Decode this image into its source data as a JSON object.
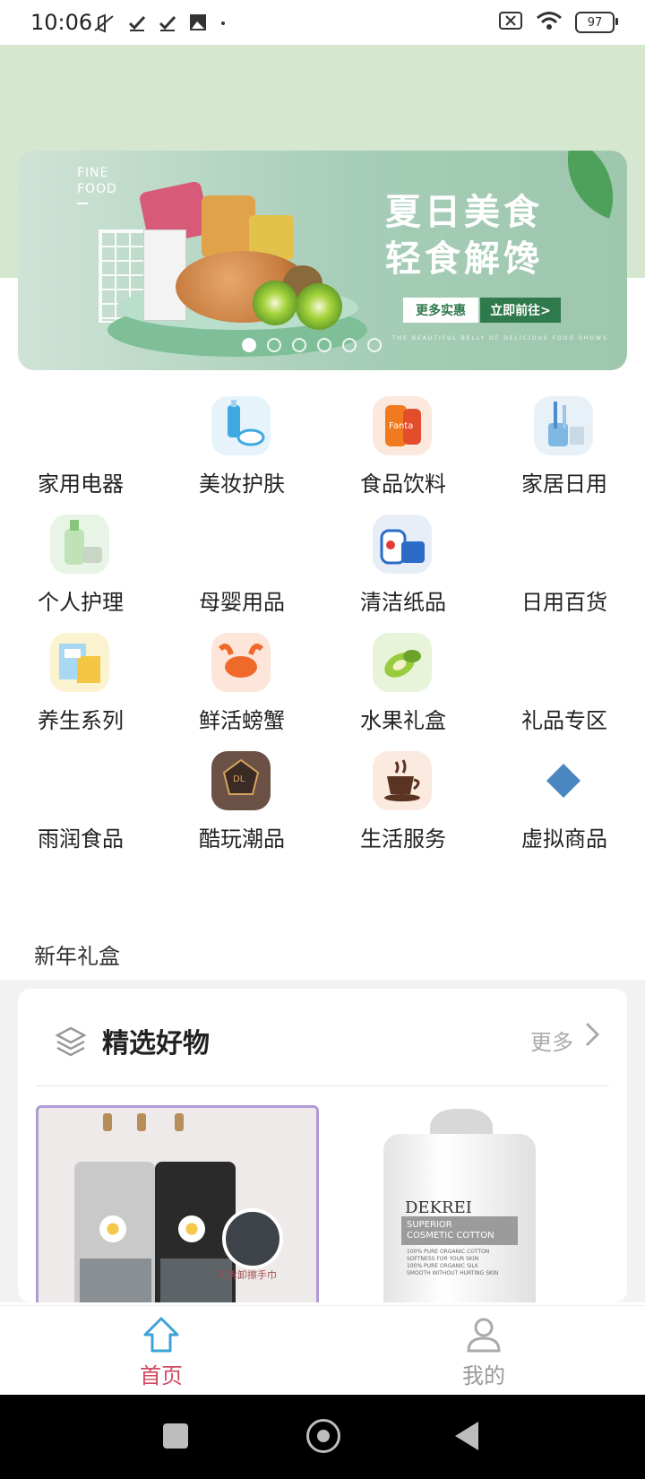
{
  "status_bar": {
    "time": "10:06",
    "battery": "97",
    "left_icons": [
      "mute-icon",
      "check-icon",
      "check-icon",
      "image-icon",
      "dot-icon"
    ],
    "right_icons": [
      "sim-off-icon",
      "wifi-icon",
      "battery-icon"
    ]
  },
  "banner": {
    "fine_food": "FINE\nFOOD",
    "title_line1": "夏日美食",
    "title_line2": "轻食解馋",
    "btn_more": "更多实惠",
    "btn_go": "立即前往>",
    "small_text": "THE BEAUTIFUL BELLY OF DELICIOUS FOOD SHOWS",
    "carousel_count": 6,
    "carousel_active": 0
  },
  "categories": [
    {
      "label": "家用电器",
      "icon": "none"
    },
    {
      "label": "美妆护肤",
      "icon": "skincare-icon"
    },
    {
      "label": "食品饮料",
      "icon": "drink-can-icon"
    },
    {
      "label": "家居日用",
      "icon": "toothbrush-cup-icon"
    },
    {
      "label": "个人护理",
      "icon": "body-wash-icon"
    },
    {
      "label": "母婴用品",
      "icon": "none"
    },
    {
      "label": "清洁纸品",
      "icon": "detergent-icon"
    },
    {
      "label": "日用百货",
      "icon": "none"
    },
    {
      "label": "养生系列",
      "icon": "health-box-icon"
    },
    {
      "label": "鲜活螃蟹",
      "icon": "crab-icon"
    },
    {
      "label": "水果礼盒",
      "icon": "kiwi-icon"
    },
    {
      "label": "礼品专区",
      "icon": "none"
    },
    {
      "label": "雨润食品",
      "icon": "none"
    },
    {
      "label": "酷玩潮品",
      "icon": "emblem-icon"
    },
    {
      "label": "生活服务",
      "icon": "coffee-icon"
    },
    {
      "label": "虚拟商品",
      "icon": "diamond-icon"
    }
  ],
  "new_year": "新年礼盒",
  "featured": {
    "title": "精选好物",
    "more": "更多",
    "products": [
      {
        "name": "apron",
        "caption": "可拆卸擦手巾"
      },
      {
        "name": "cotton",
        "brand": "DEKREI",
        "strip": "SUPERIOR\nCOSMETIC COTTON",
        "fine": "100% PURE ORGANIC COTTON\nSOFTNESS FOR YOUR SKIN\n100% PURE ORGANIC SILK\nSMOOTH WITHOUT HURTING SKIN"
      }
    ]
  },
  "bottom_nav": {
    "home": "首页",
    "me": "我的"
  },
  "colors": {
    "accent": "#d04a63",
    "hero_bg": "#d5e8cf",
    "banner_green": "#2f7a4c",
    "nav_inactive": "#999999"
  }
}
